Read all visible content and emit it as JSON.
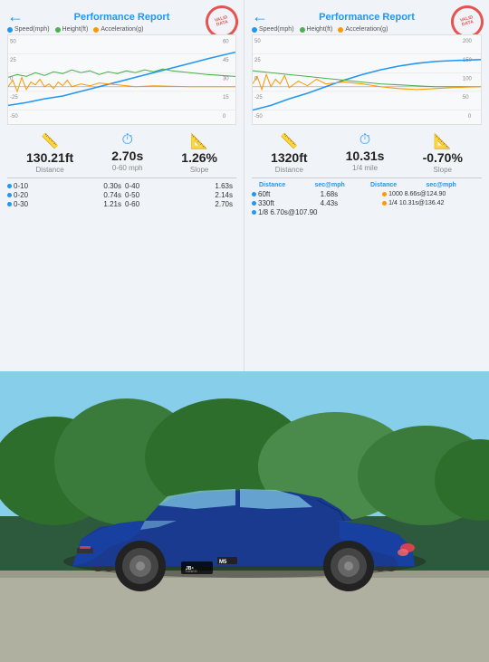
{
  "left_panel": {
    "title": "Performance Report",
    "back_label": "←",
    "stamp_text": "VALID\nDATA",
    "legend": [
      {
        "label": "Speed(mph)",
        "color": "#2196F3"
      },
      {
        "label": "Height(ft)",
        "color": "#4CAF50"
      },
      {
        "label": "Acceleration(g)",
        "color": "#FF9800"
      }
    ],
    "chart": {
      "y_left": [
        "50",
        "25",
        "0",
        "-25",
        "-50"
      ],
      "y_right": [
        "60",
        "45",
        "30",
        "15",
        "0"
      ]
    },
    "stats": [
      {
        "icon": "📏",
        "value": "130.21ft",
        "label": "Distance"
      },
      {
        "icon": "⏱",
        "value": "2.70s",
        "label": "0-60 mph"
      },
      {
        "icon": "📐",
        "value": "1.26%",
        "label": "Slope"
      }
    ],
    "times": [
      {
        "label": "0-10",
        "value": "0.30s",
        "label2": "0-40",
        "value2": "1.63s"
      },
      {
        "label": "0-20",
        "value": "0.74s",
        "label2": "0-50",
        "value2": "2.14s"
      },
      {
        "label": "0-30",
        "value": "1.21s",
        "label2": "0-60",
        "value2": "2.70s"
      }
    ]
  },
  "right_panel": {
    "title": "Performance Report",
    "back_label": "←",
    "stamp_text": "VALID\nDATA",
    "legend": [
      {
        "label": "Speed(mph)",
        "color": "#2196F3"
      },
      {
        "label": "Height(ft)",
        "color": "#4CAF50"
      },
      {
        "label": "Acceleration(g)",
        "color": "#FF9800"
      }
    ],
    "chart": {
      "y_left": [
        "50",
        "25",
        "0",
        "-25",
        "-50"
      ],
      "y_right": [
        "200",
        "150",
        "100",
        "50",
        "0"
      ]
    },
    "stats": [
      {
        "icon": "📏",
        "value": "1320ft",
        "label": "Distance"
      },
      {
        "icon": "⏱",
        "value": "10.31s",
        "label": "1/4 mile"
      },
      {
        "icon": "📐",
        "value": "-0.70%",
        "label": "Slope"
      }
    ],
    "times_headers": [
      "Distance",
      "sec@mph",
      "Distance",
      "sec@mph"
    ],
    "times": [
      {
        "label": "60ft",
        "value": "1.68s",
        "label2": "1000",
        "value2": "8.66s@124.90"
      },
      {
        "label": "330ft",
        "value": "4.43s",
        "label2": "1/4",
        "value2": "10.31s@136.42"
      },
      {
        "label": "1/8",
        "value": "6.70s@107.90",
        "label2": "",
        "value2": ""
      }
    ]
  },
  "car_section": {
    "badge_text": "JB4\nTUNED",
    "m5_label": "M5"
  }
}
